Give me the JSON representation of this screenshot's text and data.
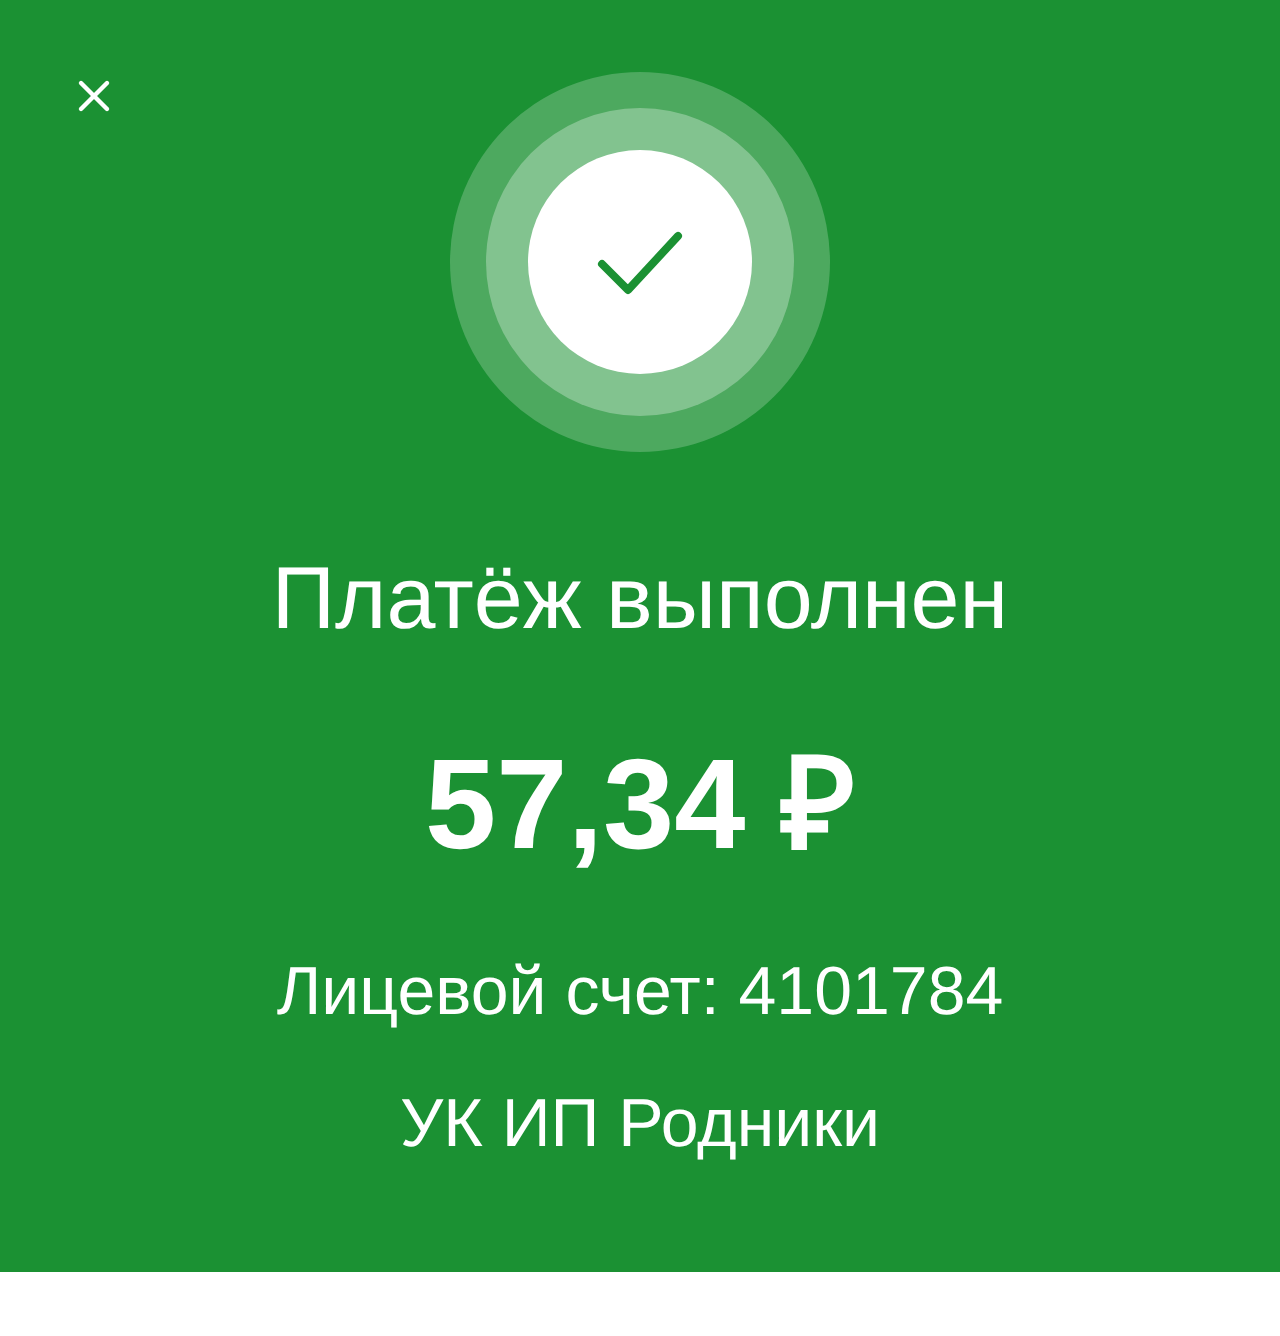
{
  "title": "Платёж выполнен",
  "amount": "57,34 ₽",
  "details": [
    "Лицевой счет: 4101784",
    "УК ИП Родники"
  ]
}
